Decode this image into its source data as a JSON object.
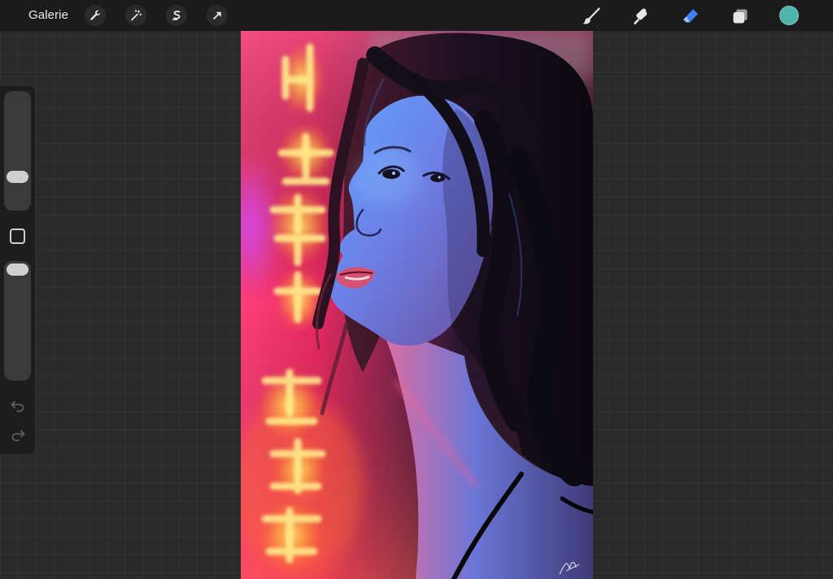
{
  "topbar": {
    "gallery_label": "Galerie",
    "actions": [
      {
        "name": "actions-wrench-icon"
      },
      {
        "name": "adjustments-wand-icon"
      },
      {
        "name": "selection-icon"
      },
      {
        "name": "transform-arrow-icon"
      }
    ],
    "tools": [
      {
        "name": "brush-icon",
        "active": false
      },
      {
        "name": "smudge-icon",
        "active": false
      },
      {
        "name": "eraser-icon",
        "active": true
      },
      {
        "name": "layers-icon",
        "active": false
      }
    ],
    "current_color": "#4fb3ad",
    "accent_color": "#3b82f6"
  },
  "sidebar": {
    "brush_size": 0.25,
    "opacity": 1.0,
    "modify_button_icon": "square-icon",
    "undo_icon": "undo-icon",
    "redo_icon": "redo-icon"
  },
  "canvas": {
    "artwork": "neon-portrait"
  }
}
